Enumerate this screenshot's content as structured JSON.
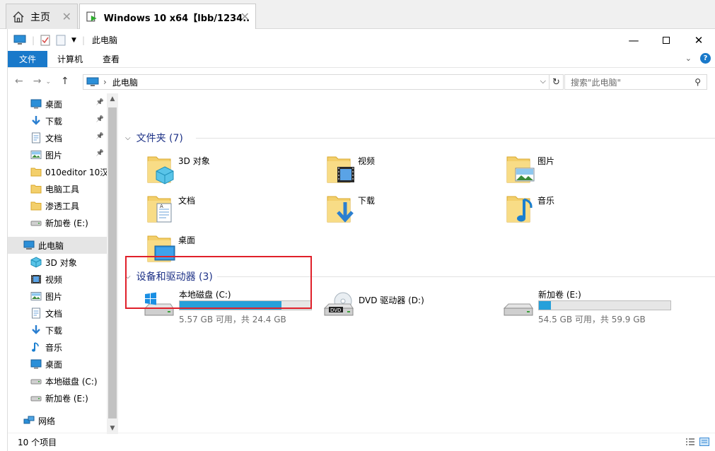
{
  "vm_tabs": {
    "home_label": "主页",
    "active_label": "Windows 10 x64【lbb/1234..."
  },
  "window": {
    "title": "此电脑"
  },
  "ribbon": {
    "tabs": [
      "文件",
      "计算机",
      "查看"
    ]
  },
  "address": {
    "path": "此电脑"
  },
  "search": {
    "placeholder": "搜索\"此电脑\""
  },
  "nav_items": [
    {
      "label": "桌面",
      "icon": "desktop-icon",
      "pinned": true
    },
    {
      "label": "下载",
      "icon": "download-icon",
      "pinned": true
    },
    {
      "label": "文档",
      "icon": "document-icon",
      "pinned": true
    },
    {
      "label": "图片",
      "icon": "pictures-icon",
      "pinned": true
    },
    {
      "label": "010editor 10汉",
      "icon": "folder-icon",
      "pinned": false
    },
    {
      "label": "电脑工具",
      "icon": "folder-icon",
      "pinned": false
    },
    {
      "label": "渗透工具",
      "icon": "folder-icon",
      "pinned": false
    },
    {
      "label": "新加卷 (E:)",
      "icon": "drive-icon",
      "pinned": false
    },
    {
      "label": "此电脑",
      "icon": "computer-icon",
      "pinned": false
    },
    {
      "label": "3D 对象",
      "icon": "3d-objects-icon",
      "pinned": false
    },
    {
      "label": "视频",
      "icon": "videos-icon",
      "pinned": false
    },
    {
      "label": "图片",
      "icon": "pictures-icon",
      "pinned": false
    },
    {
      "label": "文档",
      "icon": "document-icon",
      "pinned": false
    },
    {
      "label": "下载",
      "icon": "download-icon",
      "pinned": false
    },
    {
      "label": "音乐",
      "icon": "music-icon",
      "pinned": false
    },
    {
      "label": "桌面",
      "icon": "desktop-icon",
      "pinned": false
    },
    {
      "label": "本地磁盘 (C:)",
      "icon": "drive-icon",
      "pinned": false
    },
    {
      "label": "新加卷 (E:)",
      "icon": "drive-icon",
      "pinned": false
    },
    {
      "label": "网络",
      "icon": "network-icon",
      "pinned": false
    }
  ],
  "folders_group": {
    "label": "文件夹 (7)"
  },
  "folders": [
    {
      "name": "3D 对象",
      "icon": "3d-objects-icon"
    },
    {
      "name": "视频",
      "icon": "videos-icon"
    },
    {
      "name": "图片",
      "icon": "pictures-icon"
    },
    {
      "name": "文档",
      "icon": "document-icon"
    },
    {
      "name": "下载",
      "icon": "download-icon"
    },
    {
      "name": "音乐",
      "icon": "music-icon"
    },
    {
      "name": "桌面",
      "icon": "desktop-icon"
    }
  ],
  "drives_group": {
    "label": "设备和驱动器 (3)"
  },
  "drives": [
    {
      "name": "本地磁盘 (C:)",
      "free": "5.57 GB 可用，共 24.4 GB",
      "used_fraction": 0.772,
      "icon": "windows-drive-icon",
      "has_bar": true
    },
    {
      "name": "DVD 驱动器 (D:)",
      "free": "",
      "used_fraction": 0,
      "icon": "dvd-drive-icon",
      "has_bar": false
    },
    {
      "name": "新加卷 (E:)",
      "free": "54.5 GB 可用，共 59.9 GB",
      "used_fraction": 0.09,
      "icon": "drive-icon",
      "has_bar": true
    }
  ],
  "status": {
    "count": "10 个项目"
  },
  "colors": {
    "accent": "#1979ca",
    "bar_fill": "#26a0da",
    "highlight": "#e0202a",
    "group_text": "#1e3287"
  }
}
